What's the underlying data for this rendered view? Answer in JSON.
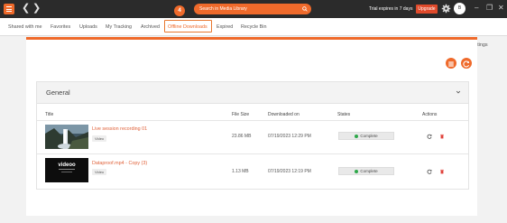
{
  "topbar": {
    "search_placeholder": "Search in Media Library",
    "trial_text": "Trial expires in 7 days",
    "upgrade_label": "Upgrade",
    "avatar_initial": "B"
  },
  "tabs": {
    "items": [
      "Shared with me",
      "Favorites",
      "Uploads",
      "My Tracking",
      "Archived",
      "Offline Downloads",
      "Expired",
      "Recycle Bin"
    ],
    "active": "Offline Downloads",
    "step_number": "4",
    "import_label": "Import Settings"
  },
  "group": {
    "title": "General"
  },
  "table": {
    "headers": [
      "Title",
      "File Size",
      "Downloaded on",
      "States",
      "Actions"
    ],
    "rows": [
      {
        "title": "Live session recording 01",
        "tag": "Video",
        "size": "23.86 MB",
        "downloaded": "07/19/2023 12:29 PM",
        "state": "Complete"
      },
      {
        "title": "Dataproof.mp4 - Copy (3)",
        "tag": "Video",
        "size": "1.13 MB",
        "downloaded": "07/19/2023 12:19 PM",
        "state": "Complete"
      }
    ]
  },
  "colors": {
    "accent": "#ef6a2b",
    "topbar": "#2b2b2b",
    "status_ok": "#2ea84a"
  },
  "icons": [
    "menu-icon",
    "back-arrow-icon",
    "forward-arrow-icon",
    "search-icon",
    "gear-icon",
    "minimize-icon",
    "restore-icon",
    "close-icon",
    "grid-view-icon",
    "refresh-icon",
    "chevron-down-icon",
    "trash-icon",
    "check-circle-icon"
  ]
}
